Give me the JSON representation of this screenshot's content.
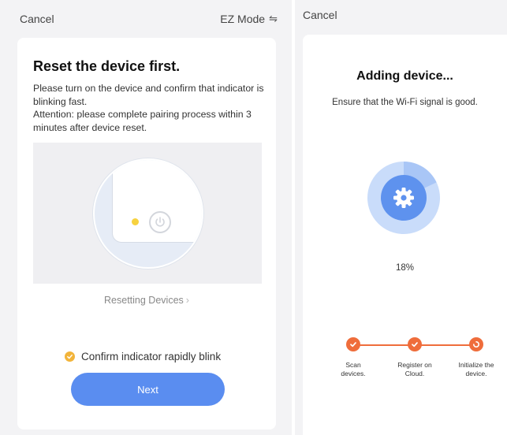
{
  "left": {
    "cancel_label": "Cancel",
    "mode_label": "EZ Mode",
    "mode_icon": "swap-arrows-icon",
    "title": "Reset the device first.",
    "desc_line1": "Please turn on the device and confirm that indicator is blinking fast.",
    "desc_line2": "Attention: please complete pairing process within 3 minutes after device reset.",
    "resetting_link": "Resetting Devices",
    "confirm_label": "Confirm indicator rapidly blink",
    "confirm_checked": true,
    "next_label": "Next",
    "colors": {
      "accent": "#5a8df0",
      "check": "#f2b43a",
      "led": "#f7d23f"
    }
  },
  "right": {
    "cancel_label": "Cancel",
    "title": "Adding device...",
    "subtitle": "Ensure that the Wi-Fi signal is good.",
    "progress_percent": 18,
    "progress_label": "18%",
    "center_icon": "gear-icon",
    "steps": [
      {
        "label": "Scan\ndevices.",
        "status": "done"
      },
      {
        "label": "Register on\nCloud.",
        "status": "done"
      },
      {
        "label": "Initialize the\ndevice.",
        "status": "in-progress"
      }
    ],
    "colors": {
      "ring_outer": "#c9dcfa",
      "ring_progress": "#a9c6f6",
      "ring_inner": "#5e92ee",
      "step": "#ef6d3b"
    }
  }
}
